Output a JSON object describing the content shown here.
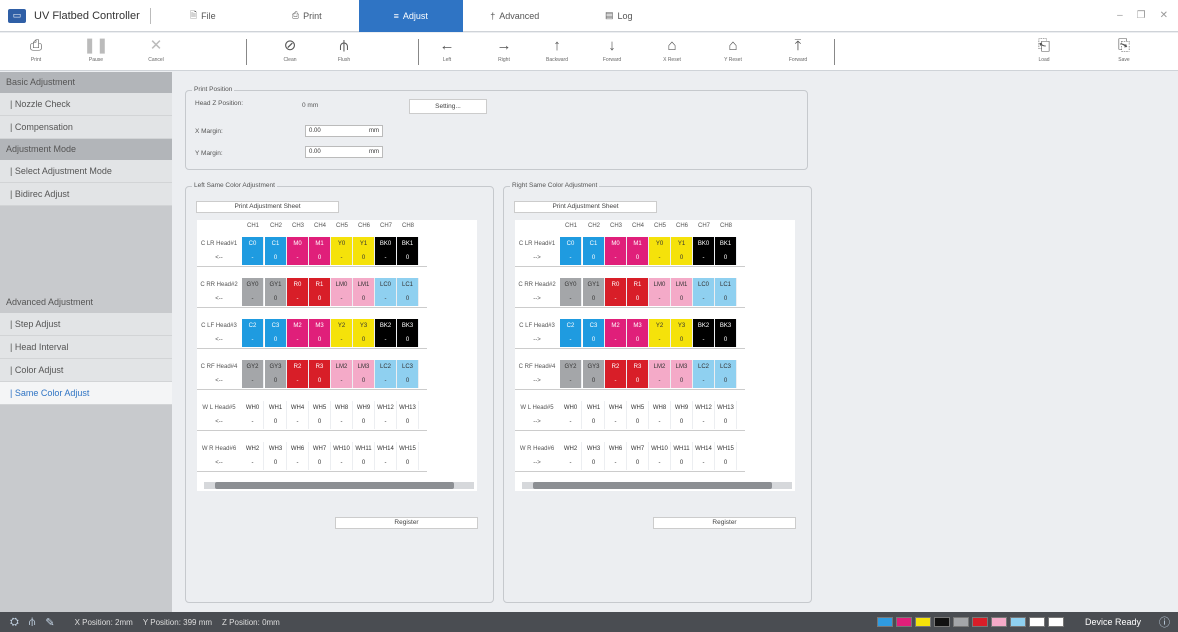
{
  "app": {
    "title": "UV Flatbed Controller",
    "tabs": [
      {
        "label": "File",
        "icon": "file-icon"
      },
      {
        "label": "Print",
        "icon": "print-icon"
      },
      {
        "label": "Adjust",
        "icon": "adjust-icon",
        "active": true
      },
      {
        "label": "Advanced",
        "icon": "advanced-icon"
      },
      {
        "label": "Log",
        "icon": "log-icon"
      }
    ]
  },
  "toolbar": {
    "print": "Print",
    "pause": "Pause",
    "cancel": "Cancel",
    "clean": "Clean",
    "flush": "Flush",
    "left": "Left",
    "right": "Right",
    "backward": "Backward",
    "forward": "Forward",
    "xreset": "X Reset",
    "yreset": "Y Reset",
    "forward2": "Forward",
    "load": "Load",
    "save": "Save"
  },
  "sidebar": {
    "basic": "Basic Adjustment",
    "nozzle": "| Nozzle Check",
    "compensation": "| Compensation",
    "mode": "Adjustment Mode",
    "selectmode": "| Select Adjustment Mode",
    "bidirec": "| Bidirec Adjust",
    "advanced": "Advanced Adjustment",
    "step": "| Step Adjust",
    "headint": "| Head Interval",
    "color": "| Color Adjust",
    "same": "| Same Color Adjust"
  },
  "printpos": {
    "title": "Print Position",
    "headz_label": "Head Z Position:",
    "headz_value": "0 mm",
    "setting": "Setting...",
    "xmargin_label": "X Margin:",
    "xmargin_value": "0.00",
    "ymargin_label": "Y Margin:",
    "ymargin_value": "0.00",
    "unit": "mm"
  },
  "channels": [
    "CH1",
    "CH2",
    "CH3",
    "CH4",
    "CH5",
    "CH6",
    "CH7",
    "CH8"
  ],
  "left": {
    "title": "Left Same Color Adjustment",
    "sheet": "Print Adjustment Sheet",
    "register": "Register",
    "arrow": "<--",
    "heads": [
      "C LR Head#1",
      "C RR Head#2",
      "C LF Head#3",
      "C RF Head#4",
      "W L Head#5",
      "W R Head#6"
    ]
  },
  "right": {
    "title": "Right Same Color Adjustment",
    "sheet": "Print Adjustment Sheet",
    "register": "Register",
    "arrow": "-->",
    "heads": [
      "C LR Head#1",
      "C RR Head#2",
      "C LF Head#3",
      "C RF Head#4",
      "W L Head#5",
      "W R Head#6"
    ]
  },
  "rows": [
    {
      "names": [
        "C0",
        "C1",
        "M0",
        "M1",
        "Y0",
        "Y1",
        "BK0",
        "BK1"
      ],
      "vals": [
        "-",
        "0",
        "-",
        "0",
        "-",
        "0",
        "-",
        "0"
      ],
      "colors": [
        "#1f9be0",
        "#1f9be0",
        "#e01f7a",
        "#e01f7a",
        "#f5e20a",
        "#f5e20a",
        "#000000",
        "#000000"
      ]
    },
    {
      "names": [
        "GY0",
        "GY1",
        "R0",
        "R1",
        "LM0",
        "LM1",
        "LC0",
        "LC1"
      ],
      "vals": [
        "-",
        "0",
        "-",
        "0",
        "-",
        "0",
        "-",
        "0"
      ],
      "colors": [
        "#a4a6a9",
        "#a4a6a9",
        "#d81e28",
        "#d81e28",
        "#f4aac8",
        "#f4aac8",
        "#8fd0f0",
        "#8fd0f0"
      ]
    },
    {
      "names": [
        "C2",
        "C3",
        "M2",
        "M3",
        "Y2",
        "Y3",
        "BK2",
        "BK3"
      ],
      "vals": [
        "-",
        "0",
        "-",
        "0",
        "-",
        "0",
        "-",
        "0"
      ],
      "colors": [
        "#1f9be0",
        "#1f9be0",
        "#e01f7a",
        "#e01f7a",
        "#f5e20a",
        "#f5e20a",
        "#000000",
        "#000000"
      ]
    },
    {
      "names": [
        "GY2",
        "GY3",
        "R2",
        "R3",
        "LM2",
        "LM3",
        "LC2",
        "LC3"
      ],
      "vals": [
        "-",
        "0",
        "-",
        "0",
        "-",
        "0",
        "-",
        "0"
      ],
      "colors": [
        "#a4a6a9",
        "#a4a6a9",
        "#d81e28",
        "#d81e28",
        "#f4aac8",
        "#f4aac8",
        "#8fd0f0",
        "#8fd0f0"
      ]
    },
    {
      "names": [
        "WH0",
        "WH1",
        "WH4",
        "WH5",
        "WH8",
        "WH9",
        "WH12",
        "WH13"
      ],
      "vals": [
        "-",
        "0",
        "-",
        "0",
        "-",
        "0",
        "-",
        "0"
      ],
      "colors": [
        "#ffffff",
        "#ffffff",
        "#ffffff",
        "#ffffff",
        "#ffffff",
        "#ffffff",
        "#ffffff",
        "#ffffff"
      ]
    },
    {
      "names": [
        "WH2",
        "WH3",
        "WH6",
        "WH7",
        "WH10",
        "WH11",
        "WH14",
        "WH15"
      ],
      "vals": [
        "-",
        "0",
        "-",
        "0",
        "-",
        "0",
        "-",
        "0"
      ],
      "colors": [
        "#ffffff",
        "#ffffff",
        "#ffffff",
        "#ffffff",
        "#ffffff",
        "#ffffff",
        "#ffffff",
        "#ffffff"
      ]
    }
  ],
  "status": {
    "xpos": "X Position: 2mm",
    "ypos": "Y Position: 399 mm",
    "zpos": "Z Position: 0mm",
    "ready": "Device Ready",
    "inks": [
      "#2f9be0",
      "#e01f7a",
      "#f5e20a",
      "#111111",
      "#a4a6a9",
      "#d81e28",
      "#f4aac8",
      "#8fd0f0",
      "#ffffff",
      "#ffffff"
    ]
  }
}
